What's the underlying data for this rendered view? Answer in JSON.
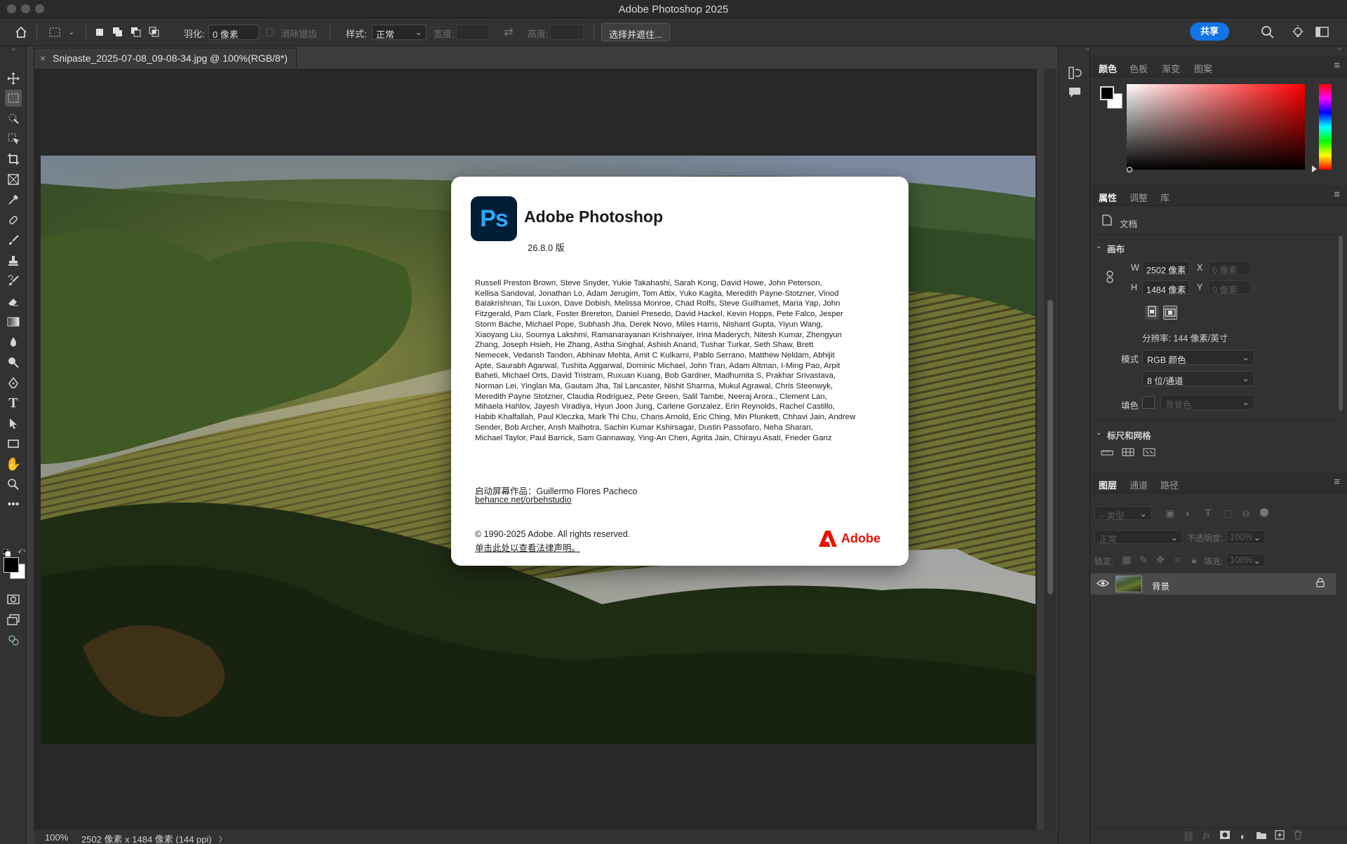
{
  "window": {
    "title": "Adobe Photoshop 2025"
  },
  "options_bar": {
    "feather_label": "羽化:",
    "feather_value": "0 像素",
    "anti_alias_label": "消除锯齿",
    "style_label": "样式:",
    "style_value": "正常",
    "width_label": "宽度:",
    "height_label": "高度:",
    "select_mask_button": "选择并遮住...",
    "share_button": "共享"
  },
  "document": {
    "tab_title": "Snipaste_2025-07-08_09-08-34.jpg @ 100%(RGB/8*)",
    "zoom": "100%",
    "status_info": "2502 像素 x 1484 像素 (144 ppi)",
    "status_arrow": "〉"
  },
  "about_dialog": {
    "logo_text": "Ps",
    "app_name": "Adobe Photoshop",
    "version": "26.8.0 版",
    "credits": [
      "Russell Preston Brown, Steve Snyder, Yukie Takahashi, Sarah Kong, David Howe, John Peterson,",
      "Kellisa Sandoval, Jonathan Lo, Adam Jerugim, Tom Attix, Yuko Kagita, Meredith Payne-Stotzner, Vinod",
      "Balakrishnan, Tai Luxon, Dave Dobish, Melissa Monroe, Chad Rolfs, Steve Guilhamet, Maria Yap, John",
      "Fitzgerald, Pam Clark, Foster Brereton, Daniel Presedo, David Hackel, Kevin Hopps, Pete Falco, Jesper",
      "Storm Bache, Michael Pope, Subhash Jha, Derek Novo, Miles Harris, Nishant Gupta, Yiyun Wang,",
      "Xiaoyang Liu, Soumya Lakshmi, Ramanarayanan Krishnaiyer, Irina Maderych, Nitesh Kumar, Zhengyun",
      "Zhang, Joseph Hsieh, He Zhang, Astha Singhal, Ashish Anand, Tushar Turkar, Seth Shaw, Brett",
      "Nemecek, Vedansh Tandon, Abhinav Mehta, Amit C Kulkarni, Pablo Serrano, Matthew Neldam, Abhijit",
      "Apte, Saurabh Agarwal, Tushita Aggarwal, Dominic Michael, John Tran, Adam Altman, I-Ming Pao, Arpit",
      "Baheti, Michael Orts, David Tristram, Ruxuan Kuang, Bob Gardner, Madhumita S, Prakhar Srivastava,",
      "Norman Lei, Yinglan Ma, Gautam Jha, Tal Lancaster, Nishit Sharma, Mukul Agrawal, Chris Steenwyk,",
      "Meredith Payne Stotzner, Claudia Rodriguez, Pete Green, Salil Tambe, Neeraj Arora., Clement Lan,",
      "Mihaela Hahlov, Jayesh Viradiya, Hyun Joon Jung, Carlene Gonzalez, Erin Reynolds, Rachel Castillo,",
      "Habib Khalfallah, Paul Kleczka, Mark Thi Chu, Charis Arnold, Eric Ching, Min Plunkett, Chhavi Jain, Andrew",
      "Sender, Bob Archer, Ansh Malhotra, Sachin Kumar Kshirsagar, Dustin Passofaro, Neha Sharan,",
      "Michael Taylor, Paul Barrick, Sam Gannaway, Ying-An Chen, Agrita Jain, Chirayu Asati, Frieder Ganz"
    ],
    "splash_label": "启动屏幕作品：Guillermo Flores Pacheco",
    "splash_link": "behance.net/orbehstudio",
    "copyright": "© 1990-2025 Adobe. All rights reserved.",
    "legal_link": "单击此处以查看法律声明。",
    "brand_wordmark": "Adobe"
  },
  "color_panel": {
    "tabs": [
      "颜色",
      "色板",
      "渐变",
      "图案"
    ],
    "foreground": "#000000",
    "background": "#ffffff",
    "hue": "#ff0000"
  },
  "properties_panel": {
    "tabs": [
      "属性",
      "调整",
      "库"
    ],
    "doc_label": "文档",
    "canvas_section": "画布",
    "w_label": "W",
    "w_value": "2502 像素",
    "h_label": "H",
    "h_value": "1484 像素",
    "x_label": "X",
    "x_placeholder": "0 像素",
    "y_label": "Y",
    "y_placeholder": "0 像素",
    "resolution": "分辨率: 144 像素/英寸",
    "mode_label": "模式",
    "mode_value": "RGB 颜色",
    "depth_value": "8 位/通道",
    "fill_label": "填色",
    "fill_value": "背景色",
    "rulers_section": "标尺和网格"
  },
  "layers_panel": {
    "tabs": [
      "图层",
      "通道",
      "路径"
    ],
    "filter_placeholder": "类型",
    "blend_mode": "正常",
    "opacity_label": "不透明度:",
    "opacity_value": "100%",
    "lock_label": "锁定:",
    "fill_label": "填充:",
    "fill_value": "100%",
    "layers": [
      {
        "name": "背景",
        "visible": true,
        "locked": true
      }
    ]
  }
}
